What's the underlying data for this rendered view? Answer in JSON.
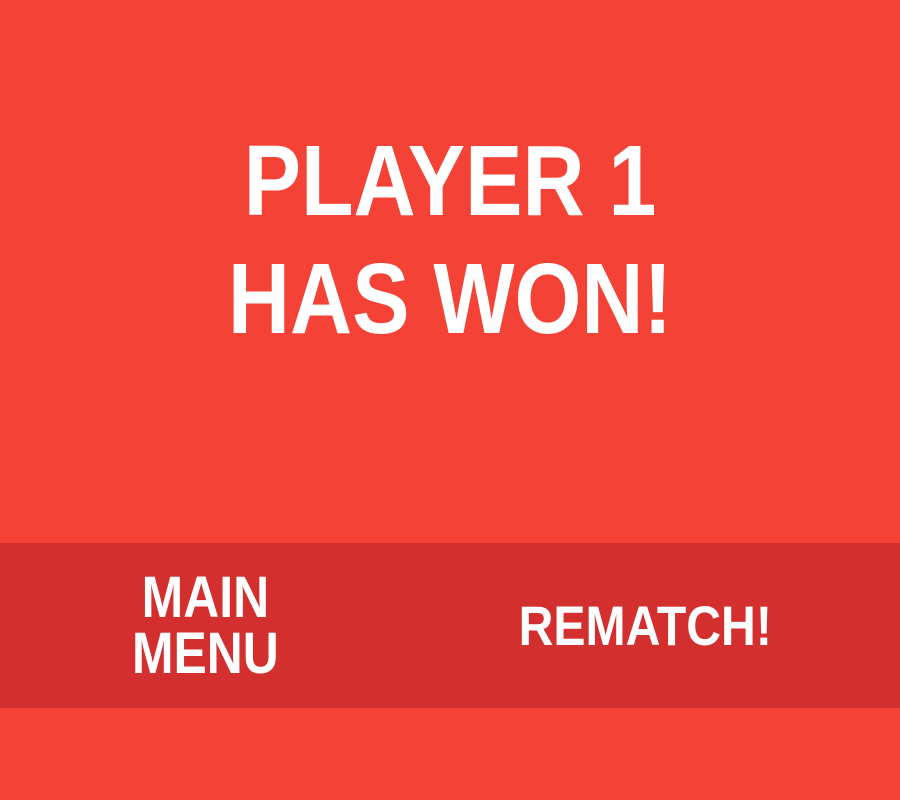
{
  "result": {
    "line1": "PLAYER 1",
    "line2": "HAS WON!"
  },
  "actions": {
    "main_menu_line1": "MAIN",
    "main_menu_line2": "MENU",
    "rematch_label": "REMATCH!"
  },
  "colors": {
    "background": "#f44336",
    "action_bar": "#d32f2f",
    "text": "#ffffff"
  }
}
